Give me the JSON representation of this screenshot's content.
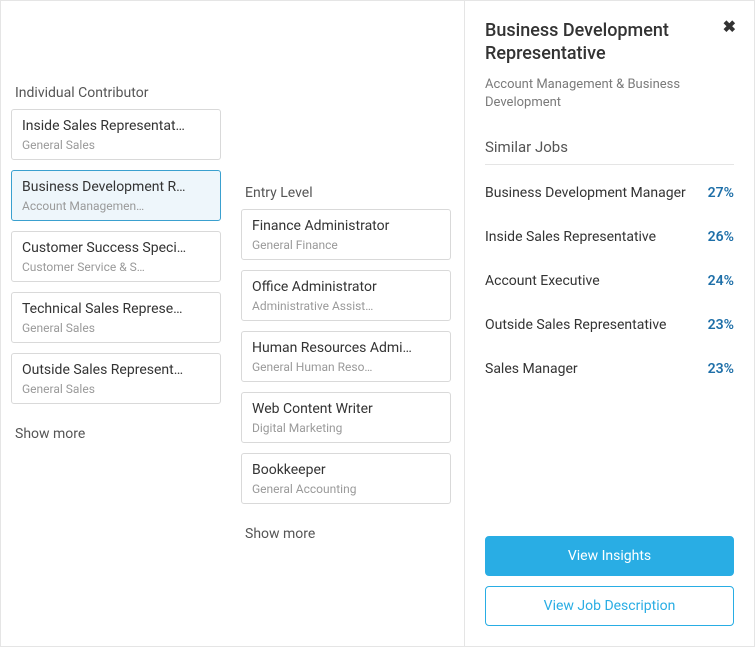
{
  "columns": {
    "individual_contributor": {
      "header": "Individual Contributor",
      "show_more": "Show more",
      "items": [
        {
          "title": "Inside Sales Representat…",
          "sub": "General Sales",
          "selected": false
        },
        {
          "title": "Business Development R…",
          "sub": "Account Managemen…",
          "selected": true
        },
        {
          "title": "Customer Success Speci…",
          "sub": "Customer Service & S…",
          "selected": false
        },
        {
          "title": "Technical Sales Represe…",
          "sub": "General Sales",
          "selected": false
        },
        {
          "title": "Outside Sales Represent…",
          "sub": "General Sales",
          "selected": false
        }
      ]
    },
    "entry_level": {
      "header": "Entry Level",
      "show_more": "Show more",
      "items": [
        {
          "title": "Finance Administrator",
          "sub": "General Finance"
        },
        {
          "title": "Office Administrator",
          "sub": "Administrative Assist…"
        },
        {
          "title": "Human Resources Admi…",
          "sub": "General Human Reso…"
        },
        {
          "title": "Web Content Writer",
          "sub": "Digital Marketing"
        },
        {
          "title": "Bookkeeper",
          "sub": "General Accounting"
        }
      ]
    }
  },
  "panel": {
    "title": "Business Development Representative",
    "subtitle": "Account Management & Business Development",
    "similar_header": "Similar Jobs",
    "similar": [
      {
        "name": "Business Development Manager",
        "pct": "27%"
      },
      {
        "name": "Inside Sales Representative",
        "pct": "26%"
      },
      {
        "name": "Account Executive",
        "pct": "24%"
      },
      {
        "name": "Outside Sales Representative",
        "pct": "23%"
      },
      {
        "name": "Sales Manager",
        "pct": "23%"
      }
    ],
    "view_insights": "View Insights",
    "view_jd": "View Job Description"
  }
}
